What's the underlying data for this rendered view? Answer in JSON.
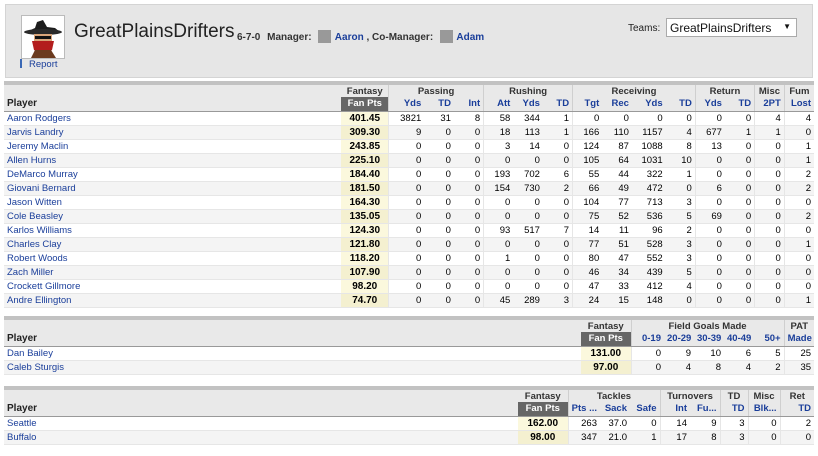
{
  "header": {
    "team_name": "GreatPlainsDrifters",
    "record": "6-7-0",
    "manager_label": "Manager:",
    "manager": "Aaron",
    "comanager_label": ", Co-Manager:",
    "comanager": "Adam",
    "report": "Report",
    "teams_label": "Teams:",
    "teams_selected": "GreatPlainsDrifters"
  },
  "offense": {
    "groups": [
      "Fantasy",
      "Passing",
      "Rushing",
      "Receiving",
      "Return",
      "Misc",
      "Fum"
    ],
    "player_label": "Player",
    "fan_label": "Fan Pts",
    "cols": [
      "Yds",
      "TD",
      "Int",
      "Att",
      "Yds",
      "TD",
      "Tgt",
      "Rec",
      "Yds",
      "TD",
      "Yds",
      "TD",
      "2PT",
      "Lost"
    ],
    "rows": [
      {
        "name": "Aaron Rodgers",
        "pts": "401.45",
        "stats": [
          "3821",
          "31",
          "8",
          "58",
          "344",
          "1",
          "0",
          "0",
          "0",
          "0",
          "0",
          "0",
          "4",
          "4"
        ]
      },
      {
        "name": "Jarvis Landry",
        "pts": "309.30",
        "stats": [
          "9",
          "0",
          "0",
          "18",
          "113",
          "1",
          "166",
          "110",
          "1157",
          "4",
          "677",
          "1",
          "1",
          "0"
        ]
      },
      {
        "name": "Jeremy Maclin",
        "pts": "243.85",
        "stats": [
          "0",
          "0",
          "0",
          "3",
          "14",
          "0",
          "124",
          "87",
          "1088",
          "8",
          "13",
          "0",
          "0",
          "1"
        ]
      },
      {
        "name": "Allen Hurns",
        "pts": "225.10",
        "stats": [
          "0",
          "0",
          "0",
          "0",
          "0",
          "0",
          "105",
          "64",
          "1031",
          "10",
          "0",
          "0",
          "0",
          "1"
        ]
      },
      {
        "name": "DeMarco Murray",
        "pts": "184.40",
        "stats": [
          "0",
          "0",
          "0",
          "193",
          "702",
          "6",
          "55",
          "44",
          "322",
          "1",
          "0",
          "0",
          "0",
          "2"
        ]
      },
      {
        "name": "Giovani Bernard",
        "pts": "181.50",
        "stats": [
          "0",
          "0",
          "0",
          "154",
          "730",
          "2",
          "66",
          "49",
          "472",
          "0",
          "6",
          "0",
          "0",
          "2"
        ]
      },
      {
        "name": "Jason Witten",
        "pts": "164.30",
        "stats": [
          "0",
          "0",
          "0",
          "0",
          "0",
          "0",
          "104",
          "77",
          "713",
          "3",
          "0",
          "0",
          "0",
          "0"
        ]
      },
      {
        "name": "Cole Beasley",
        "pts": "135.05",
        "stats": [
          "0",
          "0",
          "0",
          "0",
          "0",
          "0",
          "75",
          "52",
          "536",
          "5",
          "69",
          "0",
          "0",
          "2"
        ]
      },
      {
        "name": "Karlos Williams",
        "pts": "124.30",
        "stats": [
          "0",
          "0",
          "0",
          "93",
          "517",
          "7",
          "14",
          "11",
          "96",
          "2",
          "0",
          "0",
          "0",
          "0"
        ]
      },
      {
        "name": "Charles Clay",
        "pts": "121.80",
        "stats": [
          "0",
          "0",
          "0",
          "0",
          "0",
          "0",
          "77",
          "51",
          "528",
          "3",
          "0",
          "0",
          "0",
          "1"
        ]
      },
      {
        "name": "Robert Woods",
        "pts": "118.20",
        "stats": [
          "0",
          "0",
          "0",
          "1",
          "0",
          "0",
          "80",
          "47",
          "552",
          "3",
          "0",
          "0",
          "0",
          "0"
        ]
      },
      {
        "name": "Zach Miller",
        "pts": "107.90",
        "stats": [
          "0",
          "0",
          "0",
          "0",
          "0",
          "0",
          "46",
          "34",
          "439",
          "5",
          "0",
          "0",
          "0",
          "0"
        ]
      },
      {
        "name": "Crockett Gillmore",
        "pts": "98.20",
        "stats": [
          "0",
          "0",
          "0",
          "0",
          "0",
          "0",
          "47",
          "33",
          "412",
          "4",
          "0",
          "0",
          "0",
          "0"
        ]
      },
      {
        "name": "Andre Ellington",
        "pts": "74.70",
        "stats": [
          "0",
          "0",
          "0",
          "45",
          "289",
          "3",
          "24",
          "15",
          "148",
          "0",
          "0",
          "0",
          "0",
          "1"
        ]
      }
    ]
  },
  "kickers": {
    "groups": [
      "Fantasy",
      "Field Goals Made",
      "PAT"
    ],
    "player_label": "Player",
    "fan_label": "Fan Pts",
    "cols": [
      "0-19",
      "20-29",
      "30-39",
      "40-49",
      "50+",
      "Made"
    ],
    "rows": [
      {
        "name": "Dan Bailey",
        "pts": "131.00",
        "stats": [
          "0",
          "9",
          "10",
          "6",
          "5",
          "25"
        ]
      },
      {
        "name": "Caleb Sturgis",
        "pts": "97.00",
        "stats": [
          "0",
          "4",
          "8",
          "4",
          "2",
          "35"
        ]
      }
    ]
  },
  "defense": {
    "groups": [
      "Fantasy",
      "Tackles",
      "Turnovers",
      "TD",
      "Misc",
      "Ret"
    ],
    "player_label": "Player",
    "fan_label": "Fan Pts",
    "cols": [
      "Pts ...",
      "Sack",
      "Safe",
      "Int",
      "Fu...",
      "TD",
      "Blk...",
      "TD"
    ],
    "rows": [
      {
        "name": "Seattle",
        "pts": "162.00",
        "stats": [
          "263",
          "37.0",
          "0",
          "14",
          "9",
          "3",
          "0",
          "2"
        ]
      },
      {
        "name": "Buffalo",
        "pts": "98.00",
        "stats": [
          "347",
          "21.0",
          "1",
          "17",
          "8",
          "3",
          "0",
          "0"
        ]
      }
    ]
  }
}
